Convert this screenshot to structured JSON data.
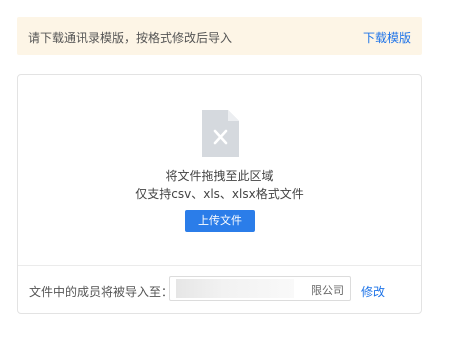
{
  "notice": {
    "text": "请下载通讯录模版，按格式修改后导入",
    "download_link": "下载模版"
  },
  "upload": {
    "icon": "excel-file-icon",
    "drop_title": "将文件拖拽至此区域",
    "supported_formats": "仅支持csv、xls、xlsx格式文件",
    "button_label": "上传文件"
  },
  "import_target": {
    "label": "文件中的成员将被导入至：",
    "organization_suffix": "限公司",
    "modify_link": "修改"
  },
  "colors": {
    "accent": "#2b7de9",
    "link": "#1f74e8",
    "notice_bg": "#fdf5e6"
  }
}
